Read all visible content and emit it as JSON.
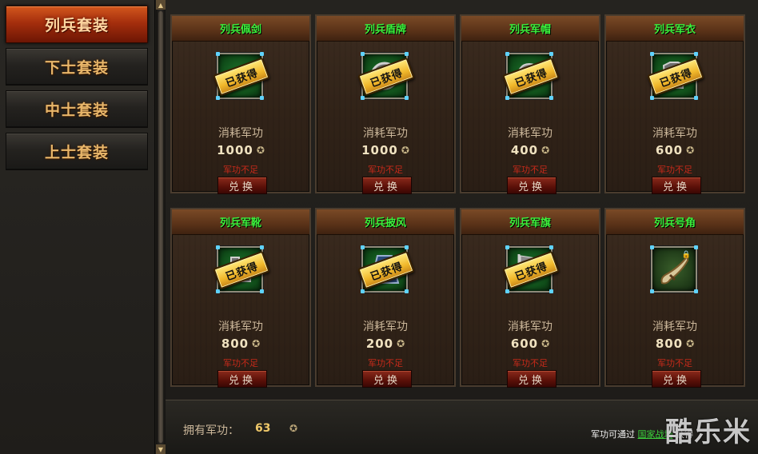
{
  "sidebar": {
    "tabs": [
      {
        "label": "列兵套装",
        "active": true
      },
      {
        "label": "下士套装",
        "active": false
      },
      {
        "label": "中士套装",
        "active": false
      },
      {
        "label": "上士套装",
        "active": false
      }
    ]
  },
  "items": [
    {
      "name": "列兵佩剑",
      "cost_label": "消耗军功",
      "cost": "1000",
      "warning": "军功不足",
      "button": "兑换",
      "obtained": true,
      "stamp": "已获得",
      "icon": "sword-icon"
    },
    {
      "name": "列兵盾牌",
      "cost_label": "消耗军功",
      "cost": "1000",
      "warning": "军功不足",
      "button": "兑换",
      "obtained": true,
      "stamp": "已获得",
      "icon": "shield-icon"
    },
    {
      "name": "列兵军帽",
      "cost_label": "消耗军功",
      "cost": "400",
      "warning": "军功不足",
      "button": "兑换",
      "obtained": true,
      "stamp": "已获得",
      "icon": "helmet-icon"
    },
    {
      "name": "列兵军衣",
      "cost_label": "消耗军功",
      "cost": "600",
      "warning": "军功不足",
      "button": "兑换",
      "obtained": true,
      "stamp": "已获得",
      "icon": "armor-icon"
    },
    {
      "name": "列兵军靴",
      "cost_label": "消耗军功",
      "cost": "800",
      "warning": "军功不足",
      "button": "兑换",
      "obtained": true,
      "stamp": "已获得",
      "icon": "boots-icon"
    },
    {
      "name": "列兵披风",
      "cost_label": "消耗军功",
      "cost": "200",
      "warning": "军功不足",
      "button": "兑换",
      "obtained": true,
      "stamp": "已获得",
      "icon": "cape-icon"
    },
    {
      "name": "列兵军旗",
      "cost_label": "消耗军功",
      "cost": "600",
      "warning": "军功不足",
      "button": "兑换",
      "obtained": true,
      "stamp": "已获得",
      "icon": "flag-icon"
    },
    {
      "name": "列兵号角",
      "cost_label": "消耗军功",
      "cost": "800",
      "warning": "军功不足",
      "button": "兑换",
      "obtained": false,
      "stamp": "",
      "icon": "horn-icon"
    }
  ],
  "footer": {
    "owned_label": "拥有军功：",
    "owned_value": "63",
    "hint_prefix": "军功可通过",
    "hint_link": "国家战场",
    "hint_suffix": "获得"
  },
  "watermark": "酷乐米",
  "colors": {
    "item_title": "#3cf23c",
    "warning": "#c62a1a",
    "active_tab": "#c24316",
    "stamp": "#f0b72a",
    "link": "#3cd23c"
  }
}
